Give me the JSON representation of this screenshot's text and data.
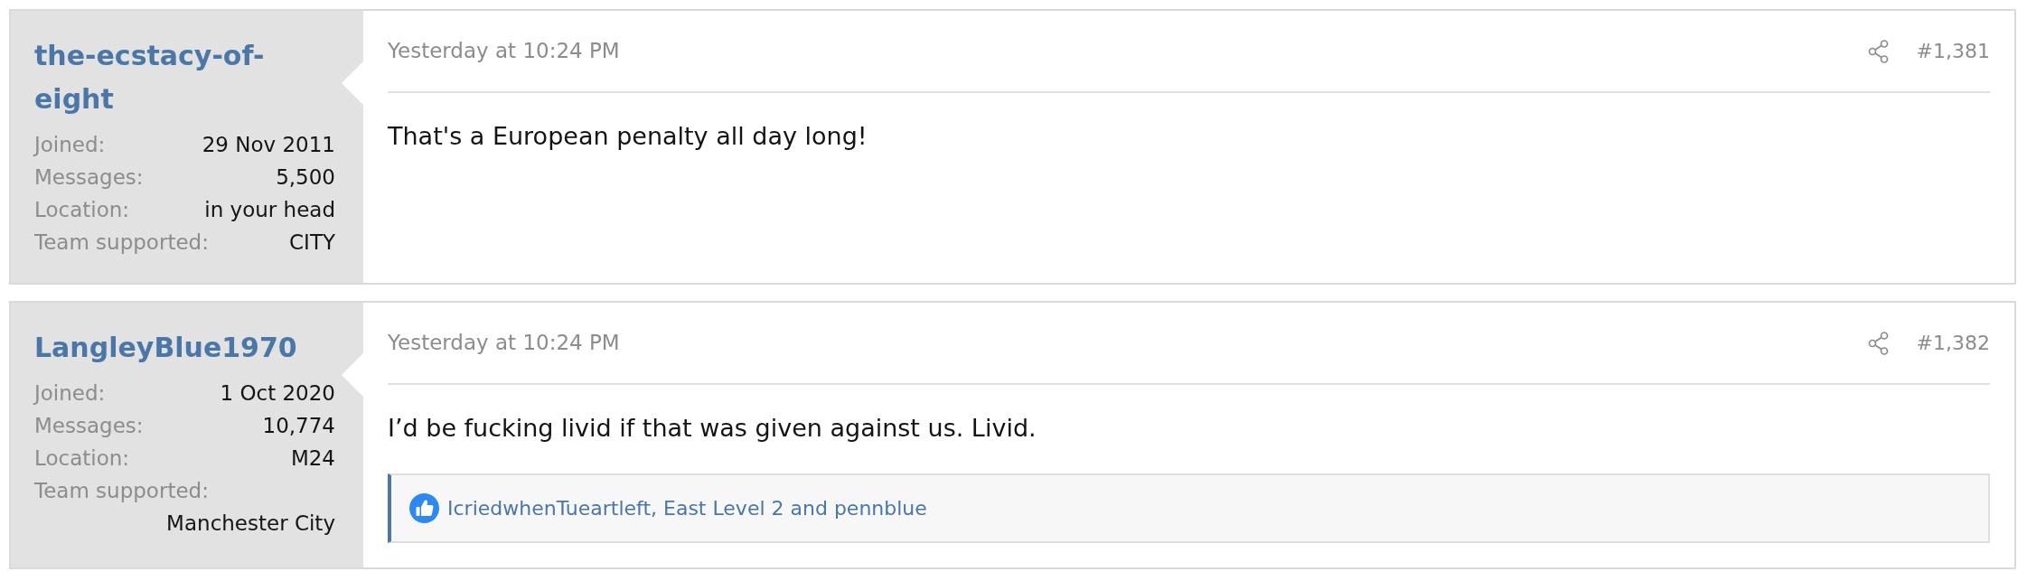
{
  "posts": [
    {
      "author": {
        "name": "the-ecstacy-of-eight",
        "fields": [
          {
            "label": "Joined:",
            "value": "29 Nov 2011"
          },
          {
            "label": "Messages:",
            "value": "5,500"
          },
          {
            "label": "Location:",
            "value": "in your head"
          },
          {
            "label": "Team supported:",
            "value": "CITY"
          }
        ]
      },
      "date": "Yesterday at 10:24 PM",
      "number": "#1,381",
      "body": "That's a European penalty all day long!"
    },
    {
      "author": {
        "name": "LangleyBlue1970",
        "fields": [
          {
            "label": "Joined:",
            "value": "1 Oct 2020"
          },
          {
            "label": "Messages:",
            "value": "10,774"
          },
          {
            "label": "Location:",
            "value": "M24"
          },
          {
            "label": "Team supported:",
            "value": "Manchester City"
          }
        ]
      },
      "date": "Yesterday at 10:24 PM",
      "number": "#1,382",
      "body": "I’d be fucking livid if that was given against us. Livid.",
      "reactions": {
        "text": "IcriedwhenTueartleft, East Level 2 and pennblue"
      }
    }
  ]
}
